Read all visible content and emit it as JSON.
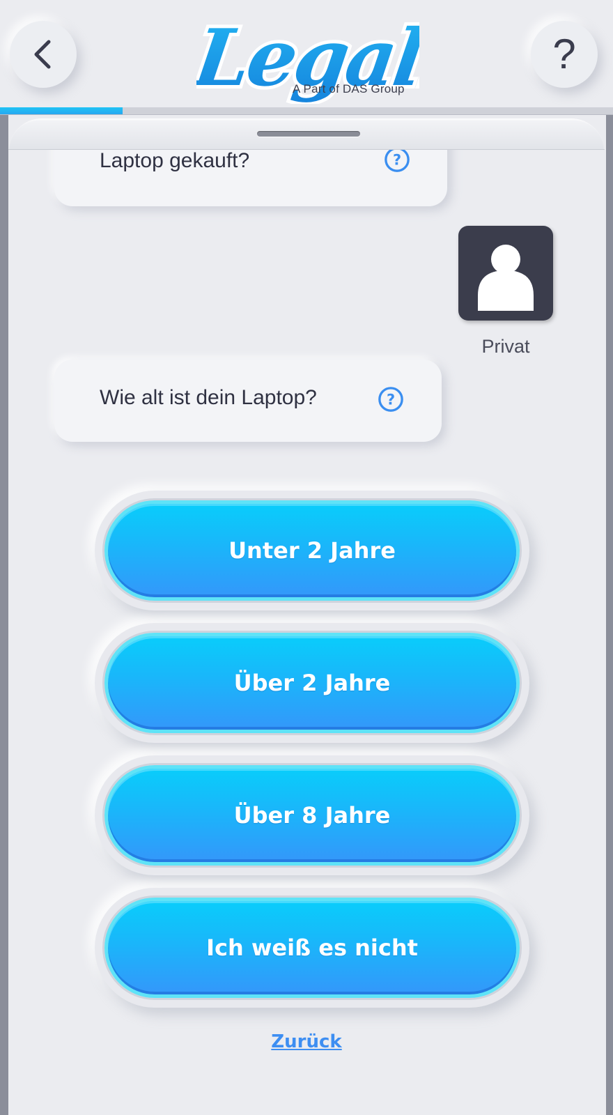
{
  "header": {
    "logo_text": "Legally",
    "logo_subtitle": "A Part of DAS Group",
    "back_icon": "chevron-left-icon",
    "help_label": "?"
  },
  "progress": {
    "value_fraction": 0.2
  },
  "chat": {
    "previous_question": "Laptop gekauft?",
    "user_answer": "Privat",
    "current_question": "Wie alt ist dein Laptop?",
    "info_icon": "question-circle-icon",
    "avatar_icon": "person-icon"
  },
  "answers": [
    {
      "label": "Unter 2 Jahre"
    },
    {
      "label": "Über 2 Jahre"
    },
    {
      "label": "Über 8 Jahre"
    },
    {
      "label": "Ich weiß es nicht"
    }
  ],
  "footer": {
    "back_link": "Zurück"
  },
  "colors": {
    "accent": "#1ab6fa",
    "accent_dark": "#3497fa",
    "link": "#3d8ef2",
    "background": "#ebecf0"
  }
}
